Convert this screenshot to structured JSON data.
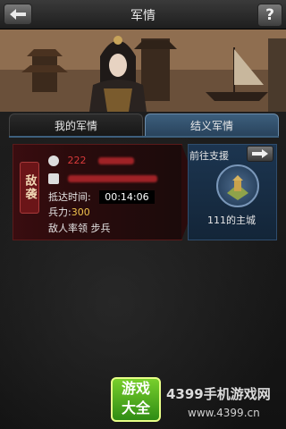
{
  "header": {
    "title": "军情",
    "help_label": "?"
  },
  "tabs": [
    {
      "label": "我的军情",
      "active": false
    },
    {
      "label": "结义军情",
      "active": true
    }
  ],
  "card": {
    "badge": "敌袭",
    "player_value": "222",
    "arrival_label": "抵达时间:",
    "arrival_time": "00:14:06",
    "troops_label": "兵力:",
    "troops_value": "300",
    "commander": "敌人率领 步兵",
    "support_label": "前往支援",
    "city_label": "111的主城"
  },
  "ad": {
    "logo_line1": "游戏",
    "logo_line2": "大全",
    "text": "4399手机游戏网",
    "url": "www.4399.cn"
  }
}
